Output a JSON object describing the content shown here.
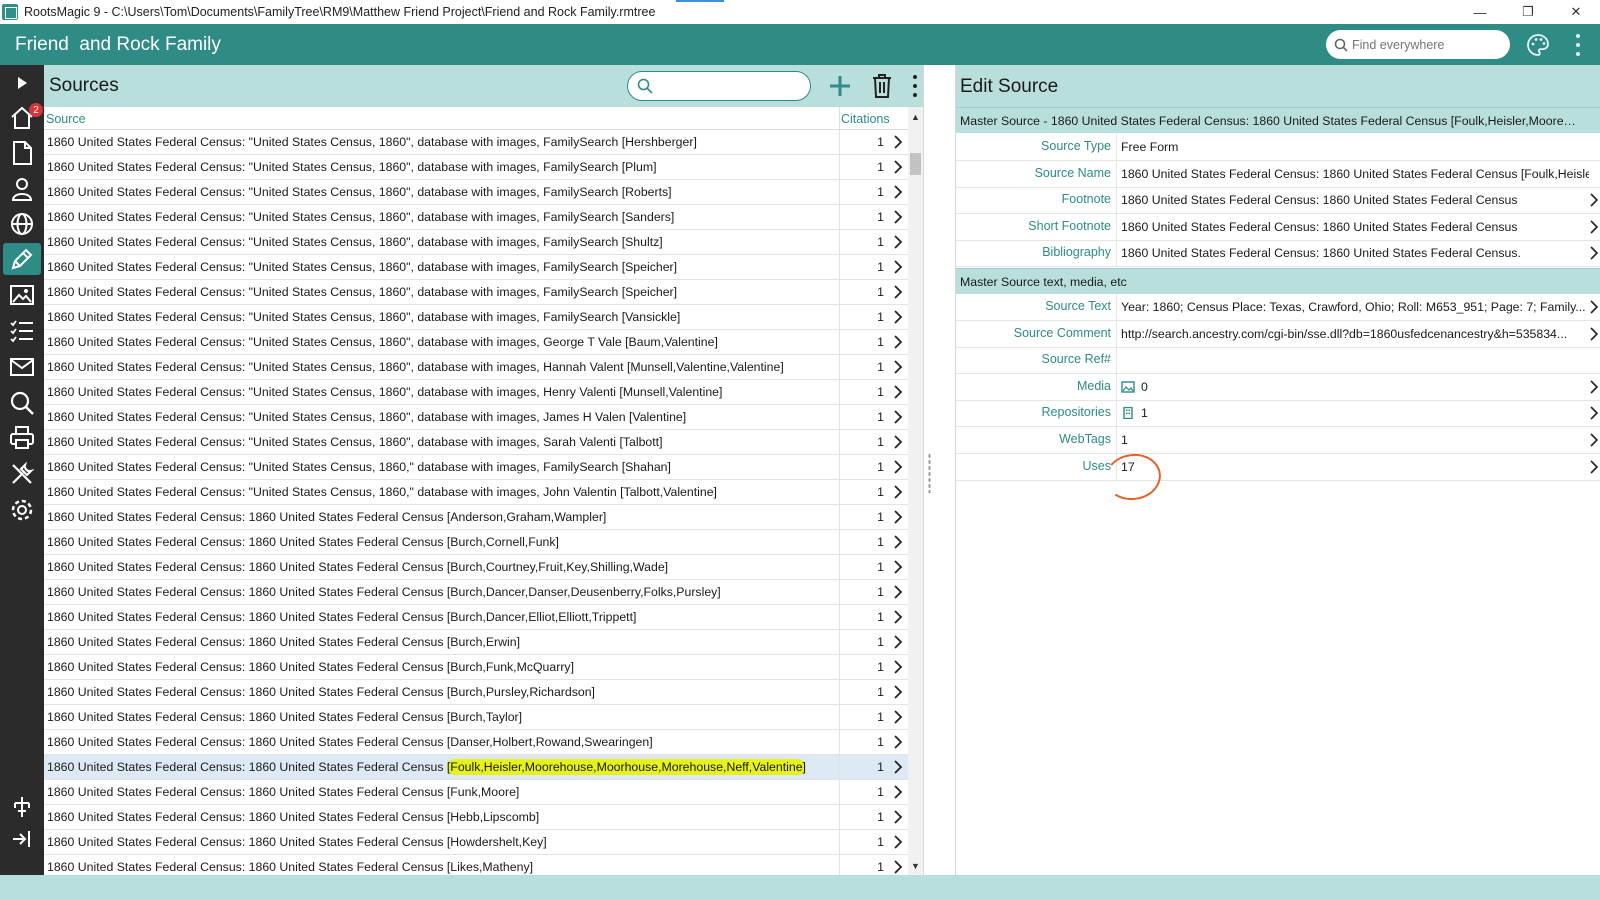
{
  "window": {
    "title": "RootsMagic 9 - C:\\Users\\Tom\\Documents\\FamilyTree\\RM9\\Matthew Friend Project\\Friend  and Rock Family.rmtree",
    "minimize": "—",
    "restore": "❐",
    "close": "✕"
  },
  "app": {
    "family_title": "Friend  and Rock Family",
    "search_placeholder": "Find everywhere"
  },
  "rail": {
    "items": [
      "expand-icon",
      "home-icon",
      "document-icon",
      "person-icon",
      "globe-icon",
      "sources-pen-icon",
      "media-icon",
      "tasks-icon",
      "mail-icon",
      "search-icon",
      "print-icon",
      "tools-icon",
      "settings-icon",
      "tree-icon",
      "share-icon"
    ],
    "home_badge": "2",
    "active": "sources-pen-icon"
  },
  "sources": {
    "title": "Sources",
    "search_placeholder": "",
    "col_source": "Source",
    "col_citations": "Citations",
    "rows": [
      {
        "text": "1860 United States Federal Census: \"United States Census, 1860\", database with images, FamilySearch  [Hershberger]",
        "count": "1"
      },
      {
        "text": "1860 United States Federal Census: \"United States Census, 1860\", database with images, FamilySearch  [Plum]",
        "count": "1"
      },
      {
        "text": "1860 United States Federal Census: \"United States Census, 1860\", database with images, FamilySearch  [Roberts]",
        "count": "1"
      },
      {
        "text": "1860 United States Federal Census: \"United States Census, 1860\", database with images, FamilySearch  [Sanders]",
        "count": "1"
      },
      {
        "text": "1860 United States Federal Census: \"United States Census, 1860\", database with images, FamilySearch  [Shultz]",
        "count": "1"
      },
      {
        "text": "1860 United States Federal Census: \"United States Census, 1860\", database with images, FamilySearch  [Speicher]",
        "count": "1"
      },
      {
        "text": "1860 United States Federal Census: \"United States Census, 1860\", database with images, FamilySearch  [Speicher]",
        "count": "1"
      },
      {
        "text": "1860 United States Federal Census: \"United States Census, 1860\", database with images, FamilySearch  [Vansickle]",
        "count": "1"
      },
      {
        "text": "1860 United States Federal Census: \"United States Census, 1860\", database with images, George T Vale [Baum,Valentine]",
        "count": "1"
      },
      {
        "text": "1860 United States Federal Census: \"United States Census, 1860\", database with images, Hannah Valent [Munsell,Valentine,Valentine]",
        "count": "1"
      },
      {
        "text": "1860 United States Federal Census: \"United States Census, 1860\", database with images, Henry Valenti [Munsell,Valentine]",
        "count": "1"
      },
      {
        "text": "1860 United States Federal Census: \"United States Census, 1860\", database with images, James H Valen [Valentine]",
        "count": "1"
      },
      {
        "text": "1860 United States Federal Census: \"United States Census, 1860\", database with images, Sarah Valenti [Talbott]",
        "count": "1"
      },
      {
        "text": "1860 United States Federal Census: \"United States Census, 1860,\" database with images, FamilySearch  [Shahan]",
        "count": "1"
      },
      {
        "text": "1860 United States Federal Census: \"United States Census, 1860,\" database with images, John Valentin [Talbott,Valentine]",
        "count": "1"
      },
      {
        "text": "1860 United States Federal Census: 1860 United States Federal Census [Anderson,Graham,Wampler]",
        "count": "1"
      },
      {
        "text": "1860 United States Federal Census: 1860 United States Federal Census [Burch,Cornell,Funk]",
        "count": "1"
      },
      {
        "text": "1860 United States Federal Census: 1860 United States Federal Census [Burch,Courtney,Fruit,Key,Shilling,Wade]",
        "count": "1"
      },
      {
        "text": "1860 United States Federal Census: 1860 United States Federal Census [Burch,Dancer,Danser,Deusenberry,Folks,Pursley]",
        "count": "1"
      },
      {
        "text": "1860 United States Federal Census: 1860 United States Federal Census [Burch,Dancer,Elliot,Elliott,Trippett]",
        "count": "1"
      },
      {
        "text": "1860 United States Federal Census: 1860 United States Federal Census [Burch,Erwin]",
        "count": "1"
      },
      {
        "text": "1860 United States Federal Census: 1860 United States Federal Census [Burch,Funk,McQuarry]",
        "count": "1"
      },
      {
        "text": "1860 United States Federal Census: 1860 United States Federal Census [Burch,Pursley,Richardson]",
        "count": "1"
      },
      {
        "text": "1860 United States Federal Census: 1860 United States Federal Census [Burch,Taylor]",
        "count": "1"
      },
      {
        "text": "1860 United States Federal Census: 1860 United States Federal Census [Danser,Holbert,Rowand,Swearingen]",
        "count": "1"
      },
      {
        "text": "1860 United States Federal Census: 1860 United States Federal Census ",
        "highlight": "[Foulk,Heisler,Moorehouse,Moorhouse,Morehouse,Neff,Valentine]",
        "count": "1",
        "selected": true
      },
      {
        "text": "1860 United States Federal Census: 1860 United States Federal Census [Funk,Moore]",
        "count": "1"
      },
      {
        "text": "1860 United States Federal Census: 1860 United States Federal Census [Hebb,Lipscomb]",
        "count": "1"
      },
      {
        "text": "1860 United States Federal Census: 1860 United States Federal Census [Howdershelt,Key]",
        "count": "1"
      },
      {
        "text": "1860 United States Federal Census: 1860 United States Federal Census [Likes,Matheny]",
        "count": "1"
      }
    ]
  },
  "edit": {
    "title": "Edit Source",
    "master_band": "Master Source - 1860 United States Federal Census: 1860 United States Federal Census [Foulk,Heisler,Moorehous...",
    "text_band": "Master Source text, media, etc",
    "fields": [
      {
        "label": "Source Type",
        "value": "Free Form",
        "chevron": false
      },
      {
        "label": "Source Name",
        "value": "1860 United States Federal Census: 1860 United States Federal Census [Foulk,Heisler,M",
        "chevron": false
      },
      {
        "label": "Footnote",
        "value": "1860 United States Federal Census: 1860 United States Federal Census",
        "chevron": true
      },
      {
        "label": "Short Footnote",
        "value": "1860 United States Federal Census: 1860 United States Federal Census",
        "chevron": true
      },
      {
        "label": "Bibliography",
        "value": "1860 United States Federal Census: 1860 United States Federal Census.",
        "chevron": true
      }
    ],
    "fields2": [
      {
        "label": "Source Text",
        "value": "Year: 1860; Census Place: Texas, Crawford, Ohio; Roll: M653_951; Page: 7; Family...",
        "chevron": true
      },
      {
        "label": "Source Comment",
        "value": "http://search.ancestry.com/cgi-bin/sse.dll?db=1860usfedcenancestry&h=535834...",
        "chevron": true
      },
      {
        "label": "Source Ref#",
        "value": "",
        "chevron": false
      },
      {
        "label": "Media",
        "value": "0",
        "icon": "media-icon",
        "chevron": true
      },
      {
        "label": "Repositories",
        "value": "1",
        "icon": "repository-icon",
        "chevron": true
      },
      {
        "label": "WebTags",
        "value": "1",
        "chevron": true
      },
      {
        "label": "Uses",
        "value": "17",
        "chevron": true
      }
    ]
  },
  "colors": {
    "teal": "#2e8b86",
    "light_teal": "#b9dfdc",
    "rail": "#2b2b2b",
    "highlight": "#e6f21a",
    "annotation": "#e3622b",
    "selected_row": "#dde9f4"
  }
}
